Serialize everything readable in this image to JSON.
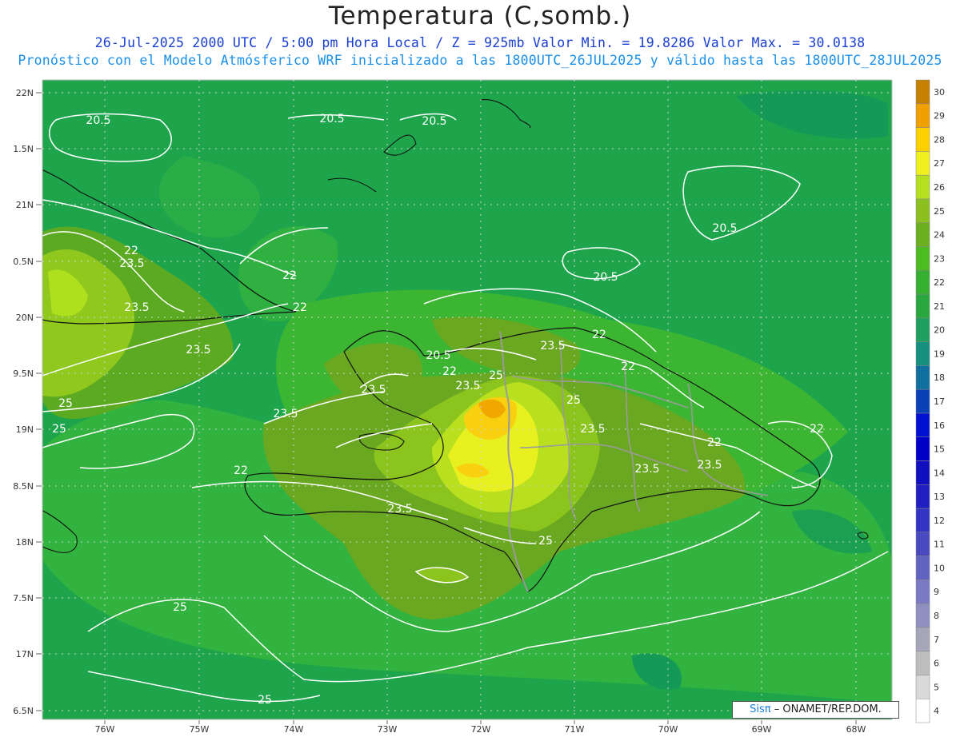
{
  "header": {
    "title": "Temperatura (C,somb.)",
    "line1": "26-Jul-2025  2000 UTC / 5:00 pm Hora Local / Z = 925mb   Valor Min. = 19.8286  Valor Max. = 30.0138",
    "line2": "Pronóstico con el Modelo Atmósferico WRF inicializado a las 1800UTC_26JUL2025 y válido hasta las  1800UTC_28JUL2025"
  },
  "axes": {
    "lat_labels": [
      "22N",
      "1.5N",
      "21N",
      "0.5N",
      "20N",
      "9.5N",
      "19N",
      "8.5N",
      "18N",
      "7.5N",
      "17N",
      "6.5N"
    ],
    "lon_labels": [
      "76W",
      "75W",
      "74W",
      "73W",
      "72W",
      "71W",
      "70W",
      "69W",
      "68W"
    ]
  },
  "colorbar": {
    "labels": [
      "4",
      "5",
      "6",
      "7",
      "8",
      "9",
      "10",
      "11",
      "12",
      "13",
      "14",
      "15",
      "16",
      "17",
      "18",
      "19",
      "20",
      "21",
      "22",
      "23",
      "24",
      "25",
      "26",
      "27",
      "28",
      "29",
      "30"
    ],
    "colors": [
      "#ffffff",
      "#d9d9d9",
      "#bdbdbd",
      "#a6a6b8",
      "#9090c0",
      "#7a7ac4",
      "#6262c0",
      "#4a4ac0",
      "#3434c4",
      "#2020c0",
      "#1010c0",
      "#0000c8",
      "#0010d0",
      "#0a40b8",
      "#1070a0",
      "#169080",
      "#20a060",
      "#2aa840",
      "#36b030",
      "#4cbc20",
      "#6cb020",
      "#8cc020",
      "#b4e020",
      "#f0f020",
      "#ffd000",
      "#f0a000",
      "#c88000"
    ]
  },
  "contours": {
    "labels": [
      "20.5",
      "20.5",
      "20.5",
      "20.5",
      "20.5",
      "20.5",
      "22",
      "22",
      "22",
      "22",
      "22",
      "22",
      "22",
      "22",
      "22",
      "23.5",
      "23.5",
      "23.5",
      "23.5",
      "23.5",
      "23.5",
      "23.5",
      "23.5",
      "23.5",
      "23.5",
      "23.5",
      "25",
      "25",
      "25",
      "25",
      "25",
      "25",
      "25"
    ]
  },
  "credit": {
    "brand": "Sisπ",
    "text": "– ONAMET/REP.DOM."
  }
}
